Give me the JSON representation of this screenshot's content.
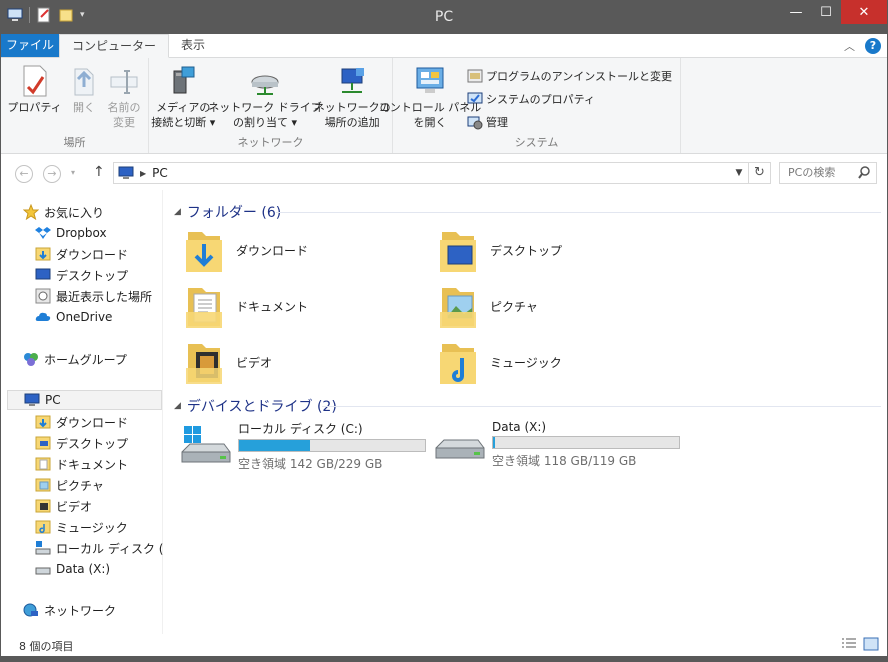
{
  "window": {
    "title": "PC"
  },
  "ribbon_tabs": {
    "file": "ファイル",
    "computer": "コンピューター",
    "view": "表示"
  },
  "ribbon": {
    "location": {
      "label": "場所",
      "properties": "プロパティ",
      "open": "開く",
      "rename_1": "名前の",
      "rename_2": "変更"
    },
    "network": {
      "label": "ネットワーク",
      "media_1": "メディアの",
      "media_2": "接続と切断 ▾",
      "map_drive_1": "ネットワーク ドライブ",
      "map_drive_2": "の割り当て ▾",
      "add_location_1": "ネットワークの",
      "add_location_2": "場所の追加"
    },
    "system": {
      "label": "システム",
      "control_panel_1": "コントロール パネル",
      "control_panel_2": "を開く",
      "uninstall": "プログラムのアンインストールと変更",
      "system_properties": "システムのプロパティ",
      "manage": "管理"
    }
  },
  "address": {
    "crumb": "PC",
    "search_placeholder": "PCの検索"
  },
  "nav": {
    "favorites": "お気に入り",
    "dropbox": "Dropbox",
    "downloads": "ダウンロード",
    "desktop": "デスクトップ",
    "recent": "最近表示した場所",
    "onedrive": "OneDrive",
    "homegroup": "ホームグループ",
    "pc": "PC",
    "pc_downloads": "ダウンロード",
    "pc_desktop": "デスクトップ",
    "pc_documents": "ドキュメント",
    "pc_pictures": "ピクチャ",
    "pc_videos": "ビデオ",
    "pc_music": "ミュージック",
    "pc_local_disk": "ローカル ディスク (C:)",
    "pc_data": "Data (X:)",
    "network": "ネットワーク"
  },
  "content": {
    "folders_header": "フォルダー (6)",
    "folders": [
      "ダウンロード",
      "デスクトップ",
      "ドキュメント",
      "ピクチャ",
      "ビデオ",
      "ミュージック"
    ],
    "drives_header": "デバイスとドライブ (2)",
    "drives": [
      {
        "name": "ローカル ディスク (C:)",
        "free": "空き領域 142 GB/229 GB",
        "used_fraction": 0.38
      },
      {
        "name": "Data (X:)",
        "free": "空き領域 118 GB/119 GB",
        "used_fraction": 0.01
      }
    ]
  },
  "status": {
    "count": "8 個の項目"
  }
}
